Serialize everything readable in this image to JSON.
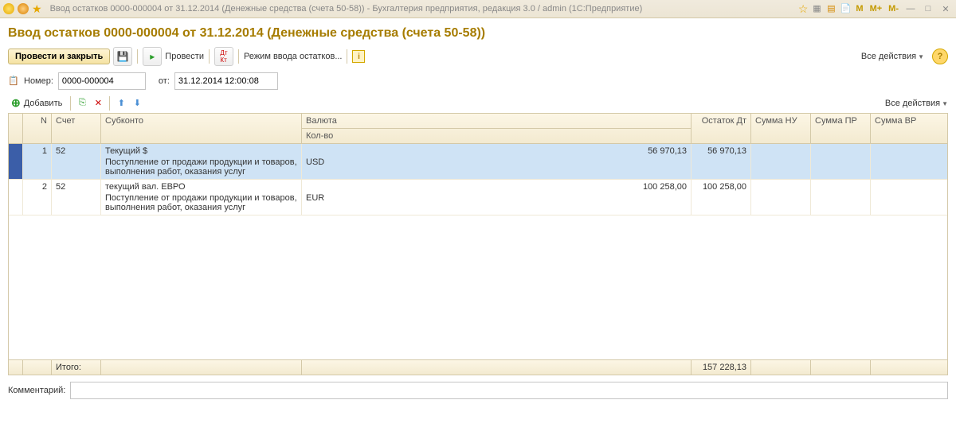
{
  "titlebar": {
    "title": "Ввод остатков 0000-000004 от 31.12.2014 (Денежные средства (счета 50-58)) - Бухгалтерия предприятия, редакция 3.0 / admin  (1С:Предприятие)",
    "m": "M",
    "mplus": "M+",
    "mminus": "M-"
  },
  "page": {
    "title": "Ввод остатков 0000-000004 от 31.12.2014 (Денежные средства (счета 50-58))"
  },
  "toolbar": {
    "post_close": "Провести и закрыть",
    "post": "Провести",
    "mode": "Режим ввода остатков...",
    "all_actions": "Все действия"
  },
  "form": {
    "number_label": "Номер:",
    "number_value": "0000-000004",
    "from_label": "от:",
    "date_value": "31.12.2014 12:00:08"
  },
  "subtoolbar": {
    "add": "Добавить",
    "all_actions": "Все действия"
  },
  "columns": {
    "n": "N",
    "account": "Счет",
    "subkonto": "Субконто",
    "currency": "Валюта",
    "qty": "Кол-во",
    "balance_dt": "Остаток Дт",
    "sum_nu": "Сумма НУ",
    "sum_pr": "Сумма ПР",
    "sum_vr": "Сумма ВР"
  },
  "rows": [
    {
      "n": "1",
      "account": "52",
      "subkonto1": "Текущий $",
      "subkonto2": "Поступление от продажи продукции и товаров, выполнения работ, оказания услуг",
      "currency": "USD",
      "amount": "56 970,13",
      "balance_dt": "56 970,13",
      "selected": true
    },
    {
      "n": "2",
      "account": "52",
      "subkonto1": "текущий вал. ЕВРО",
      "subkonto2": "Поступление от продажи продукции и товаров, выполнения работ, оказания услуг",
      "currency": "EUR",
      "amount": "100 258,00",
      "balance_dt": "100 258,00",
      "selected": false
    }
  ],
  "footer": {
    "total_label": "Итого:",
    "total_value": "157 228,13"
  },
  "comment": {
    "label": "Комментарий:",
    "value": ""
  }
}
